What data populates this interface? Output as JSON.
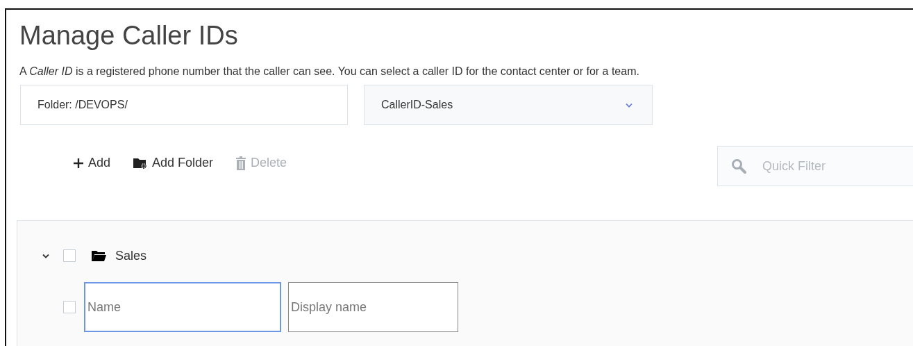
{
  "title": "Manage Caller IDs",
  "description": "A *Caller ID* is a registered phone number that the caller can see. You can select a caller ID for the contact center or for a team.",
  "folder_field": {
    "value": "Folder: /DEVOPS/"
  },
  "caller_id_dropdown": {
    "value": "CallerID-Sales"
  },
  "toolbar": [
    {
      "kind": "add",
      "label": "Add",
      "disabled": false
    },
    {
      "kind": "add_folder",
      "label": "Add Folder",
      "disabled": false
    },
    {
      "kind": "delete",
      "label": "Delete",
      "disabled": true
    }
  ],
  "quick_filter": {
    "placeholder": "Quick Filter"
  },
  "tree": [
    {
      "label": "Sales",
      "expanded": true,
      "checked": false,
      "children": [
        {
          "kind": "new_entry",
          "checked": false,
          "name_placeholder": "Name",
          "name_focused": true,
          "display_name_placeholder": "Display name"
        }
      ]
    }
  ]
}
